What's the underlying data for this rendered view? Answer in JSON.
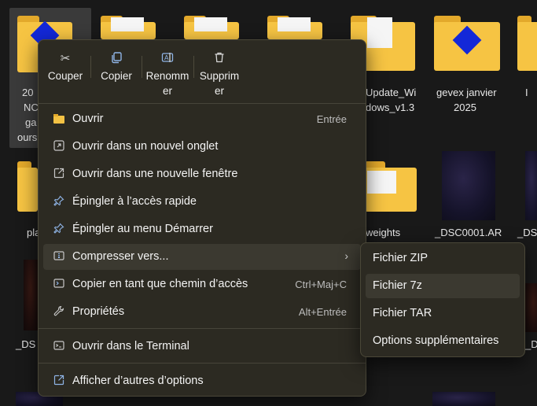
{
  "background": {
    "tiles": [
      {
        "label": "20"
      },
      {
        "label": "NC"
      },
      {
        "label": "ga"
      },
      {
        "label": "ours"
      },
      {
        "label": "Update_Wi"
      },
      {
        "label": "dows_v1.3"
      },
      {
        "label": "gevex janvier"
      },
      {
        "label": "2025"
      },
      {
        "label": "pla"
      },
      {
        "label": "weights"
      },
      {
        "label": "_DSC0001.AR"
      },
      {
        "label": "_DS"
      },
      {
        "label": "_DS"
      },
      {
        "label": "_DS"
      },
      {
        "label": "I"
      }
    ]
  },
  "toolbar": {
    "cut": "Couper",
    "copy": "Copier",
    "rename_1": "Renomm",
    "rename_2": "er",
    "delete_1": "Supprim",
    "delete_2": "er"
  },
  "menu": {
    "items": [
      {
        "label": "Ouvrir",
        "shortcut": "Entrée",
        "icon": "folder-icon"
      },
      {
        "label": "Ouvrir dans un nouvel onglet",
        "shortcut": "",
        "icon": "new-tab-icon"
      },
      {
        "label": "Ouvrir dans une nouvelle fenêtre",
        "shortcut": "",
        "icon": "new-window-icon"
      },
      {
        "label": "Épingler à l’accès rapide",
        "shortcut": "",
        "icon": "pin-icon"
      },
      {
        "label": "Épingler au menu Démarrer",
        "shortcut": "",
        "icon": "pin-icon"
      },
      {
        "label": "Compresser vers...",
        "shortcut": "",
        "icon": "zip-icon"
      },
      {
        "label": "Copier en tant que chemin d’accès",
        "shortcut": "Ctrl+Maj+C",
        "icon": "copy-path-icon"
      },
      {
        "label": "Propriétés",
        "shortcut": "Alt+Entrée",
        "icon": "wrench-icon"
      },
      {
        "label": "Ouvrir dans le Terminal",
        "shortcut": "",
        "icon": "terminal-icon"
      },
      {
        "label": "Afficher d’autres d’options",
        "shortcut": "",
        "icon": "more-options-icon"
      }
    ]
  },
  "submenu": {
    "items": [
      {
        "label": "Fichier ZIP"
      },
      {
        "label": "Fichier 7z"
      },
      {
        "label": "Fichier TAR"
      },
      {
        "label": "Options supplémentaires"
      }
    ]
  },
  "colors": {
    "menu_bg": "#2c2a22",
    "hover_bg": "#3b3930",
    "folder_yellow": "#f6c443"
  }
}
